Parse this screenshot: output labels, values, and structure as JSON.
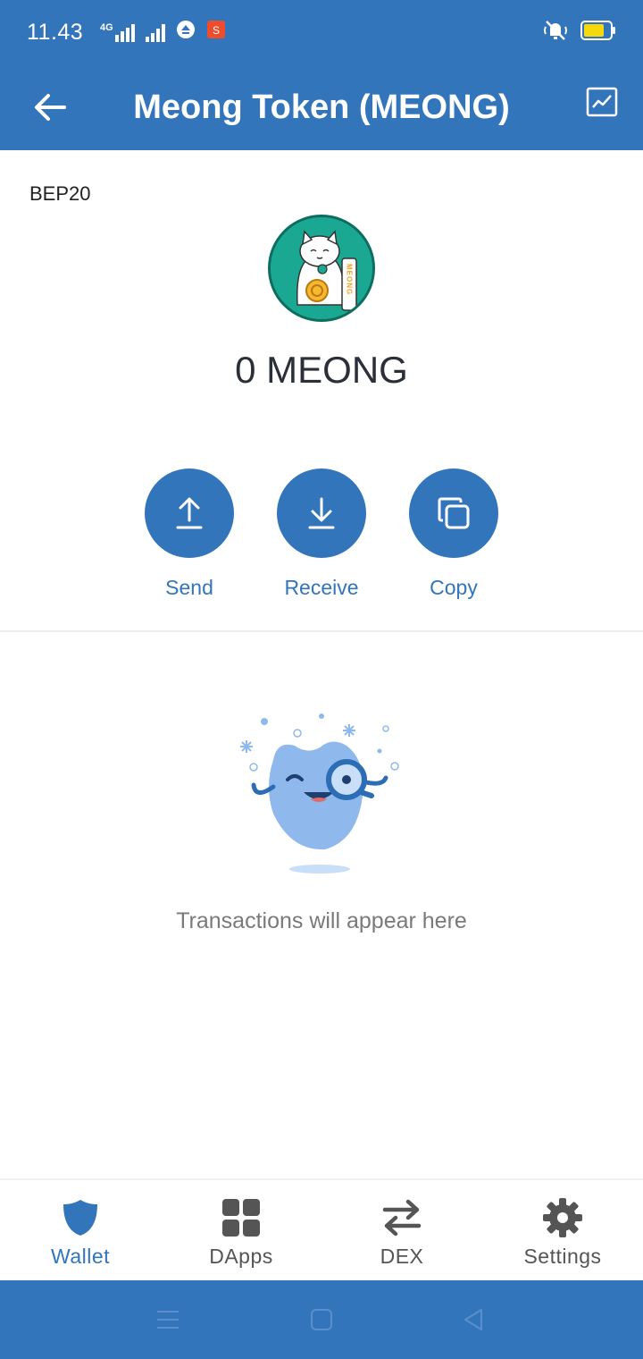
{
  "status_bar": {
    "time": "11.43",
    "network": "4G",
    "icons": [
      "signal-4g-icon",
      "signal-icon",
      "sync-icon",
      "shop-icon",
      "mute-icon",
      "battery-icon"
    ]
  },
  "app_bar": {
    "title": "Meong Token (MEONG)",
    "back_icon": "arrow-left-icon",
    "chart_icon": "price-chart-icon"
  },
  "token": {
    "network": "BEP20",
    "logo_text": "MEONG",
    "balance": "0 MEONG"
  },
  "actions": [
    {
      "label": "Send",
      "icon": "upload-icon"
    },
    {
      "label": "Receive",
      "icon": "download-icon"
    },
    {
      "label": "Copy",
      "icon": "copy-icon"
    }
  ],
  "empty_state": {
    "message": "Transactions will appear here"
  },
  "tabs": [
    {
      "label": "Wallet",
      "icon": "shield-icon",
      "active": true
    },
    {
      "label": "DApps",
      "icon": "grid-icon",
      "active": false
    },
    {
      "label": "DEX",
      "icon": "swap-icon",
      "active": false
    },
    {
      "label": "Settings",
      "icon": "gear-icon",
      "active": false
    }
  ],
  "colors": {
    "primary": "#3375BB",
    "logo_bg": "#1aa893",
    "inactive": "#555555",
    "illustration": "#8fb9ec"
  }
}
